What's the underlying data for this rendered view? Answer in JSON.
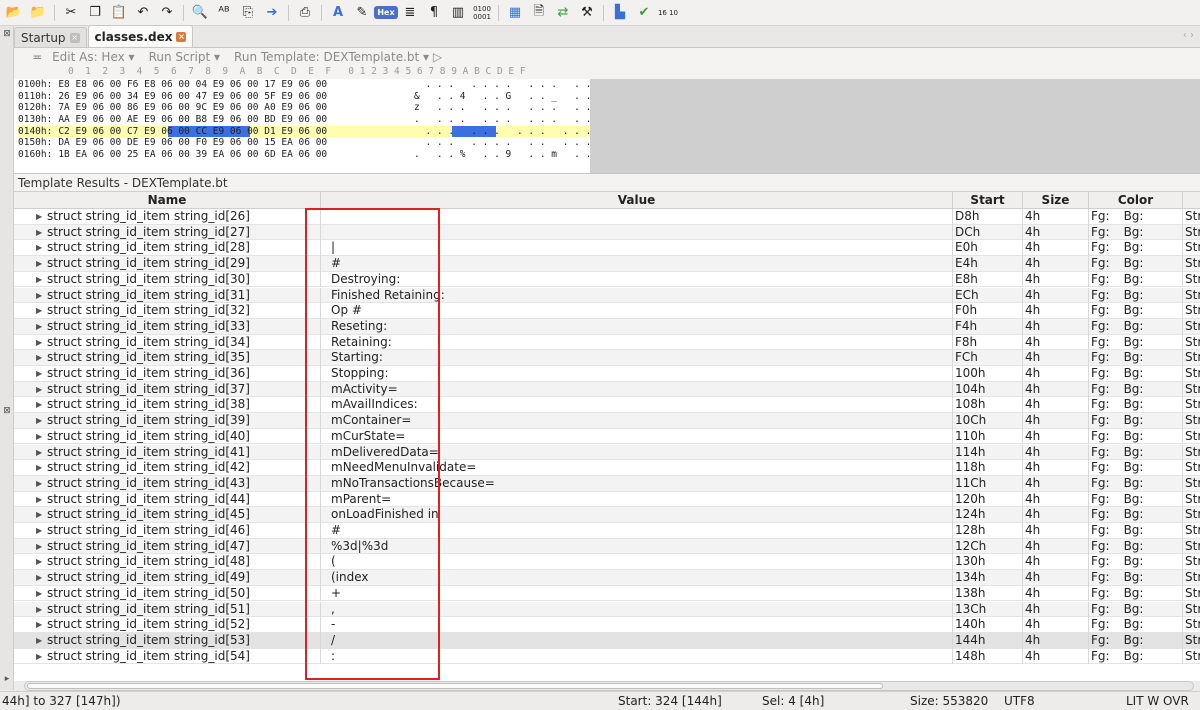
{
  "toolbar": {
    "icons": [
      "open-file-icon",
      "open-folder-icon",
      "cut-icon",
      "copy-icon",
      "paste-icon",
      "undo-icon",
      "redo-icon",
      "find-icon",
      "find-replace-icon",
      "find-in-files-icon",
      "goto-icon",
      "print-icon",
      "font-icon",
      "highlight-icon",
      "hex-toggle-icon",
      "text-view-icon",
      "paragraph-icon",
      "columns-icon",
      "binary-icon",
      "calculator-icon",
      "inspector-icon",
      "compare-icon",
      "tools-icon",
      "histogram-icon",
      "checksum-icon",
      "base-convert-icon"
    ],
    "hex_label": "Hex",
    "binary_label": "0100 0001",
    "base_label": "16 10"
  },
  "tabs": [
    {
      "label": "Startup",
      "active": false
    },
    {
      "label": "classes.dex",
      "active": true
    }
  ],
  "editor_menu": {
    "edit_as": "Edit As: Hex ▾",
    "run_script": "Run Script ▾",
    "run_template": "Run Template: DEXTemplate.bt ▾  ▷"
  },
  "hex": {
    "header": "0  1  2  3  4  5  6  7  8  9  A  B  C  D  E  F   0 1 2 3 4 5 6 7 8 9 A B C D E F",
    "rows": [
      {
        "addr": "0100h:",
        "bytes": "E8 E8 06 00 F6 E8 06 00 04 E9 06 00 17 E9 06 00",
        "ascii": "  . . .   . . . .   . . .   . ."
      },
      {
        "addr": "0110h:",
        "bytes": "26 E9 06 00 34 E9 06 00 47 E9 06 00 5F E9 06 00",
        "ascii": "&   . . 4   . . G   . . _   . ."
      },
      {
        "addr": "0120h:",
        "bytes": "7A E9 06 00 86 E9 06 00 9C E9 06 00 A0 E9 06 00",
        "ascii": "z   . . .   . . .   . . .   . ."
      },
      {
        "addr": "0130h:",
        "bytes": "AA E9 06 00 AE E9 06 00 B8 E9 06 00 BD E9 06 00",
        "ascii": ".   . . .   . . .   . . .   . ."
      },
      {
        "addr": "0140h:",
        "bytes": "C2 E9 06 00 C7 E9 06 00 CC E9 06 00 D1 E9 06 00",
        "ascii": "  . . .   . . .   . . .   . . ."
      },
      {
        "addr": "0150h:",
        "bytes": "DA E9 06 00 DE E9 06 00 F0 E9 06 00 15 EA 06 00",
        "ascii": "  . . .   . . . .   . .   . . ."
      },
      {
        "addr": "0160h:",
        "bytes": "1B EA 06 00 25 EA 06 00 39 EA 06 00 6D EA 06 00",
        "ascii": ".   . . %   . . 9   . . m   . ."
      }
    ]
  },
  "results": {
    "title": "Template Results - DEXTemplate.bt",
    "columns": {
      "name": "Name",
      "value": "Value",
      "start": "Start",
      "size": "Size",
      "color": "Color",
      "comment": "Str"
    },
    "fg_label": "Fg:",
    "bg_label": "Bg:",
    "rows": [
      {
        "name": "struct string_id_item string_id[26]",
        "value": "",
        "start": "D8h",
        "size": "4h",
        "comment": "Str"
      },
      {
        "name": "struct string_id_item string_id[27]",
        "value": "",
        "start": "DCh",
        "size": "4h",
        "comment": "Str"
      },
      {
        "name": "struct string_id_item string_id[28]",
        "value": "  |",
        "start": "E0h",
        "size": "4h",
        "comment": "Str"
      },
      {
        "name": "struct string_id_item string_id[29]",
        "value": "#",
        "start": "E4h",
        "size": "4h",
        "comment": "Str"
      },
      {
        "name": "struct string_id_item string_id[30]",
        "value": "Destroying:",
        "start": "E8h",
        "size": "4h",
        "comment": "Str"
      },
      {
        "name": "struct string_id_item string_id[31]",
        "value": "Finished Retaining:",
        "start": "ECh",
        "size": "4h",
        "comment": "Str"
      },
      {
        "name": "struct string_id_item string_id[32]",
        "value": "Op #",
        "start": "F0h",
        "size": "4h",
        "comment": "Str"
      },
      {
        "name": "struct string_id_item string_id[33]",
        "value": "Reseting:",
        "start": "F4h",
        "size": "4h",
        "comment": "Str"
      },
      {
        "name": "struct string_id_item string_id[34]",
        "value": "Retaining:",
        "start": "F8h",
        "size": "4h",
        "comment": "Str"
      },
      {
        "name": "struct string_id_item string_id[35]",
        "value": "Starting:",
        "start": "FCh",
        "size": "4h",
        "comment": "Str"
      },
      {
        "name": "struct string_id_item string_id[36]",
        "value": "Stopping:",
        "start": "100h",
        "size": "4h",
        "comment": "Str"
      },
      {
        "name": "struct string_id_item string_id[37]",
        "value": "mActivity=",
        "start": "104h",
        "size": "4h",
        "comment": "Str"
      },
      {
        "name": "struct string_id_item string_id[38]",
        "value": "mAvailIndices:",
        "start": "108h",
        "size": "4h",
        "comment": "Str"
      },
      {
        "name": "struct string_id_item string_id[39]",
        "value": "mContainer=",
        "start": "10Ch",
        "size": "4h",
        "comment": "Str"
      },
      {
        "name": "struct string_id_item string_id[40]",
        "value": "mCurState=",
        "start": "110h",
        "size": "4h",
        "comment": "Str"
      },
      {
        "name": "struct string_id_item string_id[41]",
        "value": "mDeliveredData=",
        "start": "114h",
        "size": "4h",
        "comment": "Str"
      },
      {
        "name": "struct string_id_item string_id[42]",
        "value": "mNeedMenuInvalidate=",
        "start": "118h",
        "size": "4h",
        "comment": "Str"
      },
      {
        "name": "struct string_id_item string_id[43]",
        "value": "mNoTransactionsBecause=",
        "start": "11Ch",
        "size": "4h",
        "comment": "Str"
      },
      {
        "name": "struct string_id_item string_id[44]",
        "value": "mParent=",
        "start": "120h",
        "size": "4h",
        "comment": "Str"
      },
      {
        "name": "struct string_id_item string_id[45]",
        "value": "onLoadFinished in",
        "start": "124h",
        "size": "4h",
        "comment": "Str"
      },
      {
        "name": "struct string_id_item string_id[46]",
        "value": "#",
        "start": "128h",
        "size": "4h",
        "comment": "Str"
      },
      {
        "name": "struct string_id_item string_id[47]",
        "value": "%3d|%3d",
        "start": "12Ch",
        "size": "4h",
        "comment": "Str"
      },
      {
        "name": "struct string_id_item string_id[48]",
        "value": "(",
        "start": "130h",
        "size": "4h",
        "comment": "Str"
      },
      {
        "name": "struct string_id_item string_id[49]",
        "value": "(index",
        "start": "134h",
        "size": "4h",
        "comment": "Str"
      },
      {
        "name": "struct string_id_item string_id[50]",
        "value": "+",
        "start": "138h",
        "size": "4h",
        "comment": "Str"
      },
      {
        "name": "struct string_id_item string_id[51]",
        "value": ",",
        "start": "13Ch",
        "size": "4h",
        "comment": "Str"
      },
      {
        "name": "struct string_id_item string_id[52]",
        "value": "-",
        "start": "140h",
        "size": "4h",
        "comment": "Str"
      },
      {
        "name": "struct string_id_item string_id[53]",
        "value": "/",
        "start": "144h",
        "size": "4h",
        "comment": "Str",
        "selected": true
      },
      {
        "name": "struct string_id_item string_id[54]",
        "value": ":",
        "start": "148h",
        "size": "4h",
        "comment": "Str"
      }
    ]
  },
  "status": {
    "range": "44h] to 327 [147h])",
    "start": "Start: 324 [144h]",
    "sel": "Sel: 4 [4h]",
    "size": "Size: 553820",
    "encoding": "UTF8",
    "modes": "LIT  W  OVR"
  },
  "colors": {
    "highlight_box": "#e02020",
    "selection": "#3c6fe0",
    "row_highlight": "#fffdb0"
  }
}
